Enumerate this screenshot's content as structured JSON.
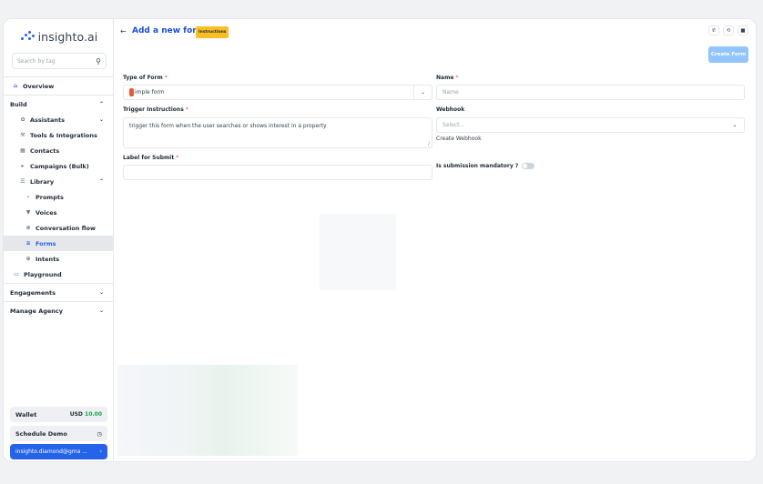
{
  "app": {
    "logo_text": "insighto.ai"
  },
  "sidebar": {
    "search_placeholder": "Search by tag",
    "items": [
      {
        "label": "Overview",
        "icon": "home-icon"
      },
      {
        "label": "Build"
      },
      {
        "label": "Assistants",
        "icon": "sparkle-icon"
      },
      {
        "label": "Tools & Integrations",
        "icon": "tools-icon"
      },
      {
        "label": "Contacts",
        "icon": "contacts-icon"
      },
      {
        "label": "Campaigns (Bulk)",
        "icon": "megaphone-icon"
      },
      {
        "label": "Library",
        "icon": "library-icon"
      },
      {
        "label": "Prompts",
        "icon": "prompt-icon"
      },
      {
        "label": "Voices",
        "icon": "mic-icon"
      },
      {
        "label": "Conversation flow",
        "icon": "flow-icon"
      },
      {
        "label": "Forms",
        "icon": "form-icon"
      },
      {
        "label": "Intents",
        "icon": "intent-icon"
      },
      {
        "label": "Playground",
        "icon": "gamepad-icon"
      },
      {
        "label": "Engagements"
      },
      {
        "label": "Manage Agency"
      }
    ],
    "wallet_label": "Wallet",
    "wallet_currency": "USD",
    "wallet_amount": "10.00",
    "schedule_demo": "Schedule Demo",
    "account": "insighto.diamond@gma ..."
  },
  "header": {
    "title": "Add a new form",
    "badge": "Instructions",
    "create_button": "Create Form"
  },
  "form": {
    "type_label": "Type of Form",
    "type_value": "imple form",
    "name_label": "Name",
    "name_placeholder": "Name",
    "trigger_label": "Trigger Instructions",
    "trigger_value": "trigger this form when the user searches or shows interest in a property",
    "webhook_label": "Webhook",
    "webhook_placeholder": "Select...",
    "create_webhook": "Create Webhook",
    "submit_label": "Label for Submit",
    "mandatory_label": "Is submission mandatory ?",
    "required_mark": "*"
  },
  "colors": {
    "accent": "#2563eb",
    "badge": "#fbbf24",
    "button_disabled": "#93c5fd"
  }
}
